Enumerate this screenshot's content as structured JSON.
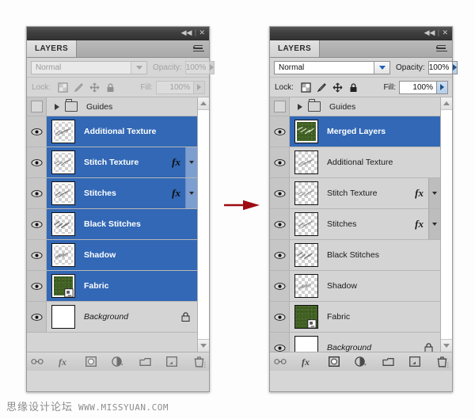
{
  "window": {
    "collapse_label": "◀◀",
    "separator": "|",
    "close_label": "✕"
  },
  "panels": [
    {
      "id": "before",
      "state": "disabled",
      "tab_label": "LAYERS",
      "blend": {
        "mode_label": "Normal",
        "opacity_label": "Opacity:",
        "opacity_value": "100%"
      },
      "lock": {
        "label": "Lock:",
        "icons": [
          "transparency-lock-icon",
          "brush-lock-icon",
          "move-lock-icon",
          "all-lock-icon"
        ],
        "fill_label": "Fill:",
        "fill_value": "100%"
      },
      "group_row": {
        "label": "Guides",
        "visible": false,
        "expanded": false
      },
      "layers": [
        {
          "name": "Additional Texture",
          "selected": true,
          "thumb": "checker",
          "fx": false,
          "locked": false,
          "italic": false,
          "linked": false
        },
        {
          "name": "Stitch Texture",
          "selected": true,
          "thumb": "checker",
          "fx": true,
          "locked": false,
          "italic": false,
          "linked": false
        },
        {
          "name": "Stitches",
          "selected": true,
          "thumb": "checker",
          "fx": true,
          "locked": false,
          "italic": false,
          "linked": false
        },
        {
          "name": "Black Stitches",
          "selected": true,
          "thumb": "checker",
          "fx": false,
          "locked": false,
          "italic": false,
          "linked": false
        },
        {
          "name": "Shadow",
          "selected": true,
          "thumb": "checker",
          "fx": false,
          "locked": false,
          "italic": false,
          "linked": false
        },
        {
          "name": "Fabric",
          "selected": true,
          "thumb": "green",
          "fx": false,
          "locked": false,
          "italic": false,
          "linked": true
        },
        {
          "name": "Background",
          "selected": false,
          "thumb": "white",
          "fx": false,
          "locked": true,
          "italic": true,
          "linked": false
        }
      ],
      "footer_buttons": [
        "link-layers-icon",
        "layer-style-fx-icon",
        "add-layer-mask-icon",
        "new-adjustment-layer-icon",
        "new-group-icon",
        "new-layer-icon",
        "delete-layer-icon"
      ]
    },
    {
      "id": "after",
      "state": "active",
      "tab_label": "LAYERS",
      "blend": {
        "mode_label": "Normal",
        "opacity_label": "Opacity:",
        "opacity_value": "100%"
      },
      "lock": {
        "label": "Lock:",
        "icons": [
          "transparency-lock-icon",
          "brush-lock-icon",
          "move-lock-icon",
          "all-lock-icon"
        ],
        "fill_label": "Fill:",
        "fill_value": "100%"
      },
      "group_row": {
        "label": "Guides",
        "visible": false,
        "expanded": false
      },
      "layers": [
        {
          "name": "Merged Layers",
          "selected": true,
          "thumb": "green",
          "fx": false,
          "locked": false,
          "italic": false,
          "linked": false
        },
        {
          "name": "Additional Texture",
          "selected": false,
          "thumb": "checker",
          "fx": false,
          "locked": false,
          "italic": false,
          "linked": false
        },
        {
          "name": "Stitch Texture",
          "selected": false,
          "thumb": "checker",
          "fx": true,
          "locked": false,
          "italic": false,
          "linked": false
        },
        {
          "name": "Stitches",
          "selected": false,
          "thumb": "checker",
          "fx": true,
          "locked": false,
          "italic": false,
          "linked": false
        },
        {
          "name": "Black Stitches",
          "selected": false,
          "thumb": "checker",
          "fx": false,
          "locked": false,
          "italic": false,
          "linked": false
        },
        {
          "name": "Shadow",
          "selected": false,
          "thumb": "checker",
          "fx": false,
          "locked": false,
          "italic": false,
          "linked": false
        },
        {
          "name": "Fabric",
          "selected": false,
          "thumb": "green",
          "fx": false,
          "locked": false,
          "italic": false,
          "linked": true
        },
        {
          "name": "Background",
          "selected": false,
          "thumb": "white",
          "fx": false,
          "locked": true,
          "italic": true,
          "linked": false
        }
      ],
      "footer_buttons": [
        "link-layers-icon",
        "layer-style-fx-icon",
        "add-layer-mask-icon",
        "new-adjustment-layer-icon",
        "new-group-icon",
        "new-layer-icon",
        "delete-layer-icon"
      ]
    }
  ],
  "transition": {
    "arrow_color": "#9e0b12",
    "direction": "right"
  },
  "watermark": {
    "chinese": "思缘设计论坛",
    "url": "WWW.MISSYUAN.COM",
    "color": "#8d8d8d"
  },
  "fx_glyph": "fx",
  "colors": {
    "selection_blue": "#3268b5",
    "panel_gray": "#d6d6d6",
    "titlebar_dark": "#3f3f3f",
    "fabric_green": "#3f6021"
  }
}
